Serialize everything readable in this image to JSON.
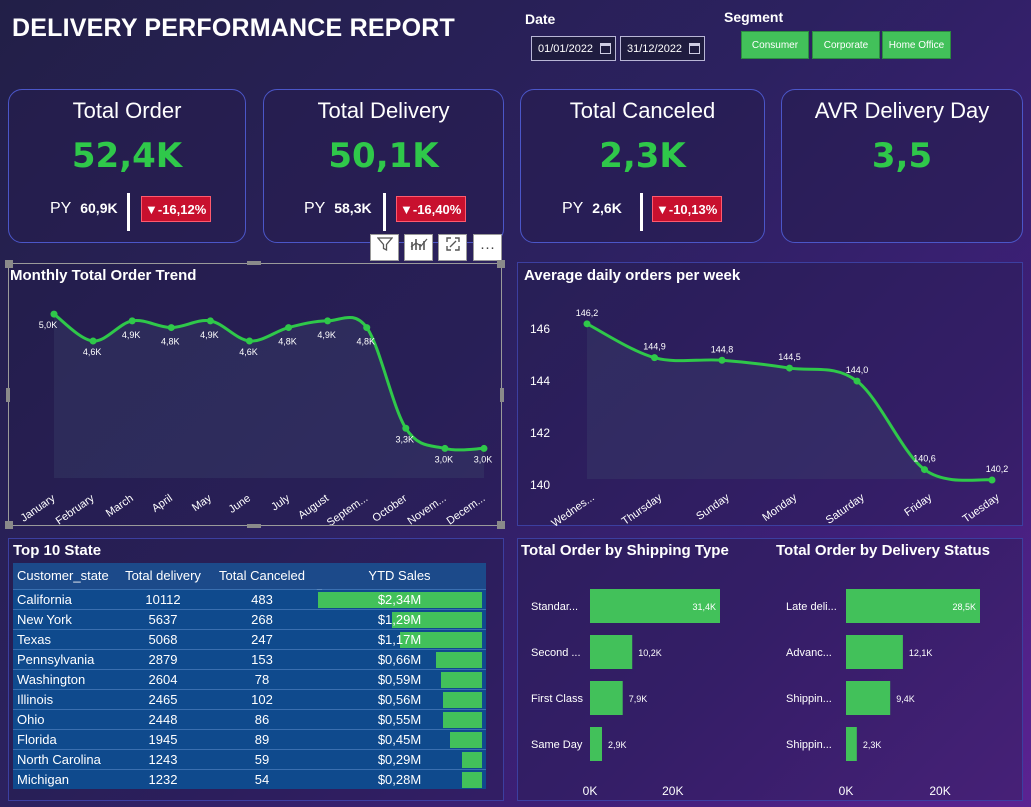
{
  "header": {
    "title": "DELIVERY PERFORMANCE REPORT"
  },
  "filters": {
    "date_label": "Date",
    "date_from": "01/01/2022",
    "date_to": "31/12/2022",
    "segment_label": "Segment",
    "segments": [
      "Consumer",
      "Corporate",
      "Home Office"
    ]
  },
  "kpis": [
    {
      "title": "Total Order",
      "value": "52,4K",
      "py_label": "PY",
      "py_value": "60,9K",
      "delta": "▼-16,12%"
    },
    {
      "title": "Total Delivery",
      "value": "50,1K",
      "py_label": "PY",
      "py_value": "58,3K",
      "delta": "▼-16,40%"
    },
    {
      "title": "Total Canceled",
      "value": "2,3K",
      "py_label": "PY",
      "py_value": "2,6K",
      "delta": "▼-10,13%"
    },
    {
      "title": "AVR Delivery Day",
      "value": "3,5"
    }
  ],
  "colors": {
    "accent_green": "#2fc84a",
    "bar_green": "#42c15a",
    "negative_red": "#c8102e",
    "table_blue": "#0f4a8d"
  },
  "visual_toolbar": {
    "icons": [
      "filter-icon",
      "drill-icon",
      "focus-mode-icon",
      "more-options-icon"
    ],
    "more_label": "···"
  },
  "monthly_chart": {
    "title": "Monthly Total Order Trend",
    "chart_data": {
      "type": "line",
      "categories": [
        "January",
        "February",
        "March",
        "April",
        "May",
        "June",
        "July",
        "August",
        "Septem...",
        "October",
        "Novem...",
        "Decem..."
      ],
      "values": [
        5.0,
        4.6,
        4.9,
        4.8,
        4.9,
        4.6,
        4.8,
        4.9,
        4.8,
        3.3,
        3.0,
        3.0
      ],
      "data_labels": [
        "5,0K",
        "4,6K",
        "4,9K",
        "4,8K",
        "4,9K",
        "4,6K",
        "4,8K",
        "4,9K",
        "4,8K",
        "3,3K",
        "3,0K",
        "3,0K"
      ],
      "ylim": [
        2.5,
        5.3
      ]
    }
  },
  "weekly_chart": {
    "title": "Average daily orders per week",
    "chart_data": {
      "type": "area",
      "categories": [
        "Wednes...",
        "Thursday",
        "Sunday",
        "Monday",
        "Saturday",
        "Friday",
        "Tuesday"
      ],
      "values": [
        146.2,
        144.9,
        144.8,
        144.5,
        144.0,
        140.6,
        140.2
      ],
      "data_labels": [
        "146,2",
        "144,9",
        "144,8",
        "144,5",
        "144,0",
        "140,6",
        "140,2"
      ],
      "y_ticks": [
        "146",
        "144",
        "142",
        "140"
      ],
      "ylim": [
        139.7,
        147
      ]
    }
  },
  "top_states": {
    "title": "Top 10 State",
    "columns": [
      "Customer_state",
      "Total delivery",
      "Total Canceled",
      "YTD Sales"
    ],
    "sort_icon": "▼",
    "rows": [
      {
        "state": "California",
        "delivery": "10112",
        "canceled": "483",
        "sales": "$2,34M",
        "sales_value": 2.34
      },
      {
        "state": "New York",
        "delivery": "5637",
        "canceled": "268",
        "sales": "$1,29M",
        "sales_value": 1.29
      },
      {
        "state": "Texas",
        "delivery": "5068",
        "canceled": "247",
        "sales": "$1,17M",
        "sales_value": 1.17
      },
      {
        "state": "Pennsylvania",
        "delivery": "2879",
        "canceled": "153",
        "sales": "$0,66M",
        "sales_value": 0.66
      },
      {
        "state": "Washington",
        "delivery": "2604",
        "canceled": "78",
        "sales": "$0,59M",
        "sales_value": 0.59
      },
      {
        "state": "Illinois",
        "delivery": "2465",
        "canceled": "102",
        "sales": "$0,56M",
        "sales_value": 0.56
      },
      {
        "state": "Ohio",
        "delivery": "2448",
        "canceled": "86",
        "sales": "$0,55M",
        "sales_value": 0.55
      },
      {
        "state": "Florida",
        "delivery": "1945",
        "canceled": "89",
        "sales": "$0,45M",
        "sales_value": 0.45
      },
      {
        "state": "North Carolina",
        "delivery": "1243",
        "canceled": "59",
        "sales": "$0,29M",
        "sales_value": 0.29
      },
      {
        "state": "Michigan",
        "delivery": "1232",
        "canceled": "54",
        "sales": "$0,28M",
        "sales_value": 0.28
      }
    ]
  },
  "shipping_chart": {
    "title": "Total Order by Shipping Type",
    "chart_data": {
      "type": "bar",
      "categories": [
        "Standar...",
        "Second ...",
        "First Class",
        "Same Day"
      ],
      "values": [
        31.4,
        10.2,
        7.9,
        2.9
      ],
      "data_labels": [
        "31,4K",
        "10,2K",
        "7,9K",
        "2,9K"
      ],
      "x_ticks": [
        "0K",
        "20K"
      ],
      "xlim": [
        0,
        33
      ]
    }
  },
  "status_chart": {
    "title": "Total Order by Delivery Status",
    "chart_data": {
      "type": "bar",
      "categories": [
        "Late deli...",
        "Advanc...",
        "Shippin...",
        "Shippin..."
      ],
      "values": [
        28.5,
        12.1,
        9.4,
        2.3
      ],
      "data_labels": [
        "28,5K",
        "12,1K",
        "9,4K",
        "2,3K"
      ],
      "x_ticks": [
        "0K",
        "20K"
      ],
      "xlim": [
        0,
        30
      ]
    }
  }
}
